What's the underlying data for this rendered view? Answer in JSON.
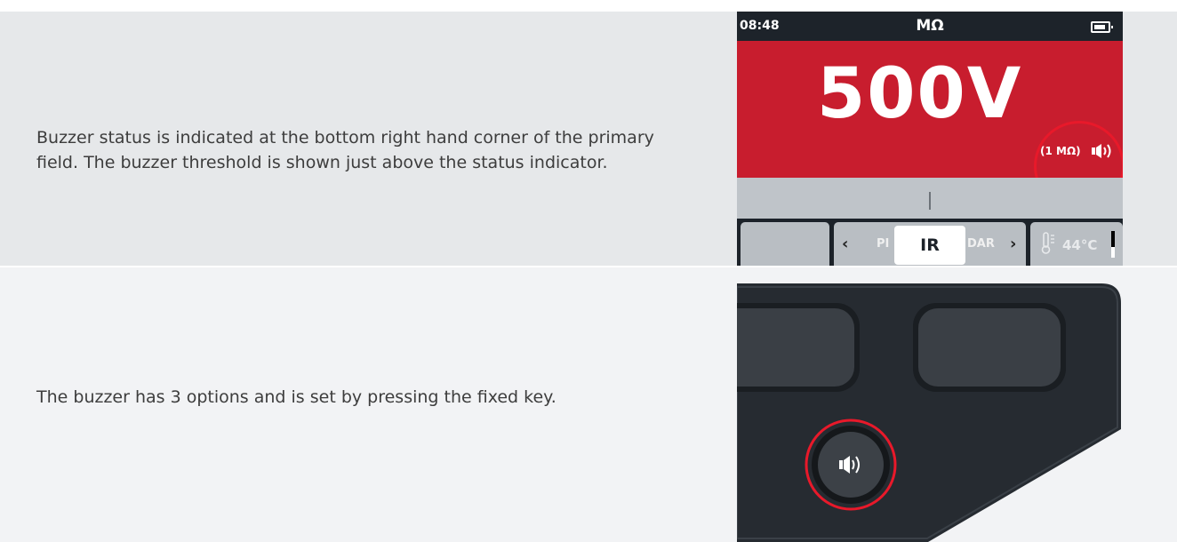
{
  "rows": [
    {
      "description": "Buzzer status is indicated at the bottom right hand corner of the primary field.  The buzzer threshold is shown just above the status indicator."
    },
    {
      "description": "The buzzer has 3 options and is set by pressing the fixed key."
    }
  ],
  "screen": {
    "time": "08:48",
    "unit": "MΩ",
    "battery_level": 1.0,
    "primary_value": "500V",
    "buzzer_threshold": "(1 MΩ)",
    "buzzer_icon": "speaker-on-icon",
    "mode_prev": "PI",
    "mode_current": "IR",
    "mode_next": "DAR",
    "temperature": "44°C",
    "temperature_bar_fraction": 0.4,
    "highlight_color": "#e8192a",
    "primary_color": "#c81d2e"
  },
  "keypad": {
    "buzzer_key_icon": "speaker-on-icon",
    "highlight_color": "#e8192a"
  }
}
